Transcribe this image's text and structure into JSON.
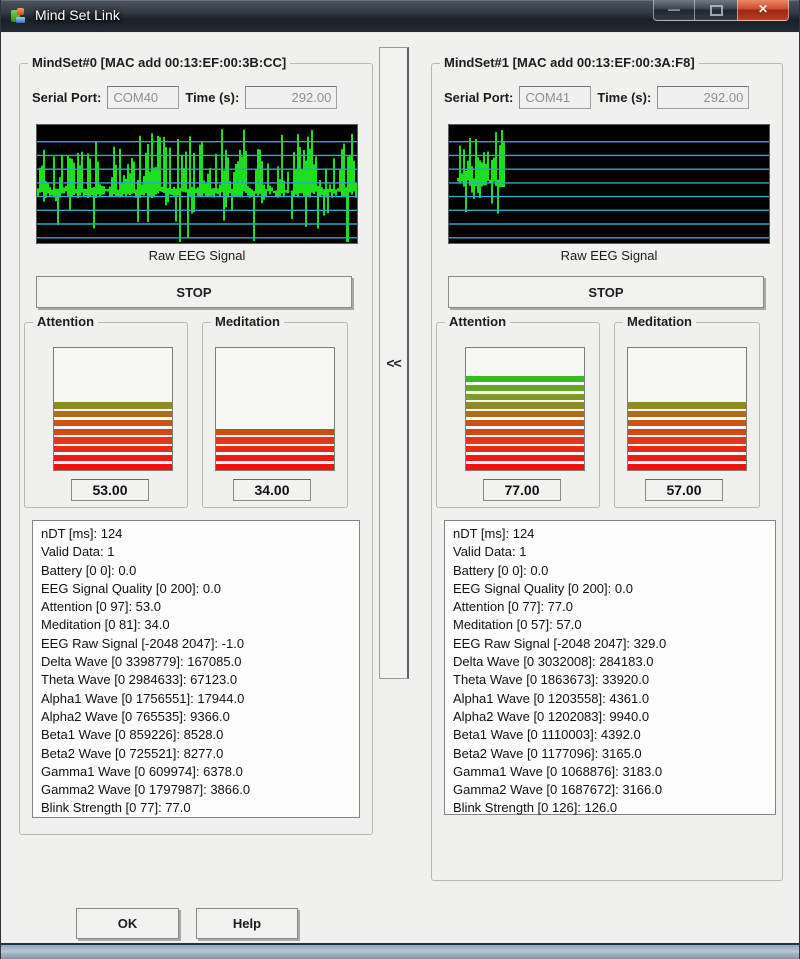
{
  "window": {
    "title": "Mind Set Link",
    "minimize_glyph": "—",
    "close_glyph": "✕"
  },
  "collapse_label": "<<",
  "ok_label": "OK",
  "help_label": "Help",
  "colors": {
    "eeg_green": "#1ddf1d",
    "eeg_grid": "#2fa9c4",
    "eeg_bg": "#000000",
    "close_red": "#c23a28"
  },
  "meter_palette": [
    "#f90f0f",
    "#f11a10",
    "#e92a13",
    "#de3a16",
    "#d04819",
    "#c4561d",
    "#ad6d20",
    "#8d8b1e",
    "#7e9a21",
    "#62a824",
    "#3fb52a",
    "#33bd2d",
    "#2bc531",
    "#24cc35"
  ],
  "panels": [
    {
      "legend": "MindSet#0 [MAC add 00:13:EF:00:3B:CC]",
      "serial_port_label": "Serial Port:",
      "serial_port": "COM40",
      "time_label": "Time (s):",
      "time": "292.00",
      "eeg_label": "Raw EEG Signal",
      "stop_label": "STOP",
      "attention": {
        "label": "Attention",
        "value": 53,
        "display": "53.00"
      },
      "meditation": {
        "label": "Meditation",
        "value": 34,
        "display": "34.00"
      },
      "eeg": {
        "seed": 7,
        "active_from": 0.0,
        "active_to": 1.0,
        "baseline": 0.56,
        "up_amp": 62,
        "down_amp": 52,
        "down_prob": 0.22,
        "grid_lines": 8,
        "end_spike": true
      },
      "info_lines": [
        "nDT [ms]: 124",
        "Valid Data: 1",
        "Battery [0 0]: 0.0",
        "EEG Signal Quality [0 200]: 0.0",
        "Attention [0 97]: 53.0",
        "Meditation [0 81]: 34.0",
        "EEG Raw Signal [-2048 2047]: -1.0",
        "Delta Wave [0 3398779]: 167085.0",
        "Theta Wave [0 2984633]: 67123.0",
        "Alpha1 Wave [0 1756551]: 17944.0",
        "Alpha2 Wave [0 765535]: 9366.0",
        "Beta1 Wave [0 859226]: 8528.0",
        "Beta2 Wave [0 725521]: 8277.0",
        "Gamma1 Wave [0 609974]: 6378.0",
        "Gamma2 Wave [0 1797987]: 3866.0",
        "Blink Strength [0 77]: 77.0"
      ]
    },
    {
      "legend": "MindSet#1 [MAC add 00:13:EF:00:3A:F8]",
      "serial_port_label": "Serial Port:",
      "serial_port": "COM41",
      "time_label": "Time (s):",
      "time": "292.00",
      "eeg_label": "Raw EEG Signal",
      "stop_label": "STOP",
      "attention": {
        "label": "Attention",
        "value": 77,
        "display": "77.00"
      },
      "meditation": {
        "label": "Meditation",
        "value": 57,
        "display": "57.00"
      },
      "eeg": {
        "seed": 3,
        "active_from": 0.02,
        "active_to": 0.17,
        "baseline": 0.47,
        "up_amp": 52,
        "down_amp": 60,
        "down_prob": 0.5,
        "grid_lines": 8,
        "end_spike": false
      },
      "info_lines": [
        "nDT [ms]: 124",
        "Valid Data: 1",
        "Battery [0 0]: 0.0",
        "EEG Signal Quality [0 200]: 0.0",
        "Attention [0 77]: 77.0",
        "Meditation [0 57]: 57.0",
        "EEG Raw Signal [-2048 2047]: 329.0",
        "Delta Wave [0 3032008]: 284183.0",
        "Theta Wave [0 1863673]: 33920.0",
        "Alpha1 Wave [0 1203558]: 4361.0",
        "Alpha2 Wave [0 1202083]: 9940.0",
        "Beta1 Wave [0 1110003]: 4392.0",
        "Beta2 Wave [0 1177096]: 3165.0",
        "Gamma1 Wave [0 1068876]: 3183.0",
        "Gamma2 Wave [0 1687672]: 3166.0",
        "Blink Strength [0 126]: 126.0"
      ]
    }
  ]
}
